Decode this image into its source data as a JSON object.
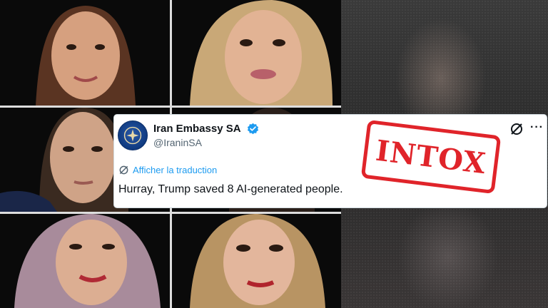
{
  "photos": [
    {
      "id": "portrait-1",
      "skin": "#d6a07f",
      "hair": "#5a3422"
    },
    {
      "id": "portrait-2",
      "skin": "#e2b394",
      "hair": "#c9a877"
    },
    {
      "id": "portrait-3",
      "skin": "#cfa387",
      "hair": "#3a2a20"
    },
    {
      "id": "portrait-4",
      "skin": "#d9b29b",
      "hair": "#2a1f1a"
    },
    {
      "id": "portrait-5",
      "skin": "#dcae92",
      "hair": "#a88b9b"
    },
    {
      "id": "portrait-6",
      "skin": "#e3b69c",
      "hair": "#b89463"
    }
  ],
  "tweet": {
    "display_name": "Iran Embassy SA",
    "handle": "@IraninSA",
    "translate_label": "Afficher la traduction",
    "text": "Hurray, Trump saved 8 AI-generated people.",
    "more_label": "···",
    "verified_color": "#1d9bf0",
    "link_color": "#1d9bf0"
  },
  "stamp": {
    "label": "INTOX",
    "color": "#e0242a"
  }
}
